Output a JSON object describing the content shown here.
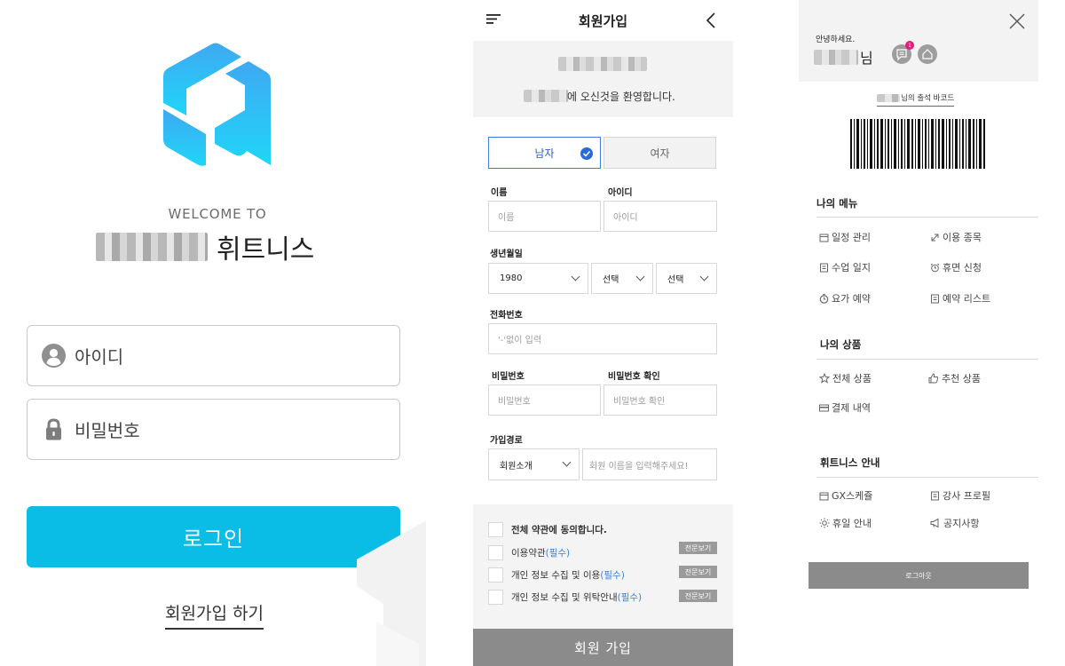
{
  "login": {
    "welcome_text": "WELCOME TO",
    "brand_name": "휘트니스",
    "id_placeholder": "아이디",
    "password_placeholder": "비밀번호",
    "login_button": "로그인",
    "signup_link": "회원가입 하기",
    "colors": {
      "primary": "#09bde6",
      "logo_top": "#3fa8f2",
      "logo_bottom": "#1fd2f5"
    },
    "icons": [
      "user-icon",
      "lock-icon",
      "app-logo"
    ]
  },
  "signup": {
    "title": "회원가입",
    "welcome_message": "에 오신것을 환영합니다.",
    "gender": {
      "male": "남자",
      "female": "여자",
      "selected": "male"
    },
    "name_label": "이름",
    "name_placeholder": "이름",
    "id_label": "아이디",
    "id_placeholder": "아이디",
    "birth_label": "생년월일",
    "birth_year": "1980",
    "birth_month": "선택",
    "birth_day": "선택",
    "phone_label": "전화번호",
    "phone_placeholder": "'-'없이 입력",
    "password_label": "비밀번호",
    "password_placeholder": "비밀번호",
    "password_confirm_label": "비밀번호 확인",
    "password_confirm_placeholder": "비밀번호 확인",
    "route_label": "가입경로",
    "route_value": "회원소개",
    "referrer_placeholder": "회원 이름을 입력해주세요!",
    "terms_all": "전체 약관에 동의합니다.",
    "terms": [
      {
        "text": "이용약관",
        "required": "(필수)",
        "view": "전문보기"
      },
      {
        "text": "개인 정보 수집 및 이용",
        "required": "(필수)",
        "view": "전문보기"
      },
      {
        "text": "개인 정보 수집 및 위탁안내",
        "required": "(필수)",
        "view": "전문보기"
      }
    ],
    "join_button": "회원 가입",
    "colors": {
      "accent": "#3d7fe0",
      "button": "#8b8b8b"
    }
  },
  "drawer": {
    "greeting": "안녕하세요.",
    "name_suffix": "님",
    "notification_count": "1",
    "barcode_title": "님의 출석 바코드",
    "my_menu_title": "나의 메뉴",
    "my_menu": [
      {
        "label": "일정 관리",
        "icon": "calendar-icon"
      },
      {
        "label": "이용 종목",
        "icon": "expand-icon"
      },
      {
        "label": "수업 일지",
        "icon": "journal-icon"
      },
      {
        "label": "휴면 신청",
        "icon": "alarm-icon"
      },
      {
        "label": "요가 예약",
        "icon": "clock-icon"
      },
      {
        "label": "예약 리스트",
        "icon": "list-icon"
      }
    ],
    "my_products_title": "나의 상품",
    "my_products": [
      {
        "label": "전체 상품",
        "icon": "star-icon"
      },
      {
        "label": "추천 상품",
        "icon": "thumbs-up-icon"
      },
      {
        "label": "결제 내역",
        "icon": "card-icon"
      }
    ],
    "guide_title": "휘트니스 안내",
    "guide": [
      {
        "label": "GX스케쥴",
        "icon": "calendar-icon"
      },
      {
        "label": "강사 프로필",
        "icon": "profile-icon"
      },
      {
        "label": "휴일 안내",
        "icon": "sun-icon"
      },
      {
        "label": "공지사항",
        "icon": "megaphone-icon"
      }
    ],
    "logout_button": "로그아웃"
  }
}
